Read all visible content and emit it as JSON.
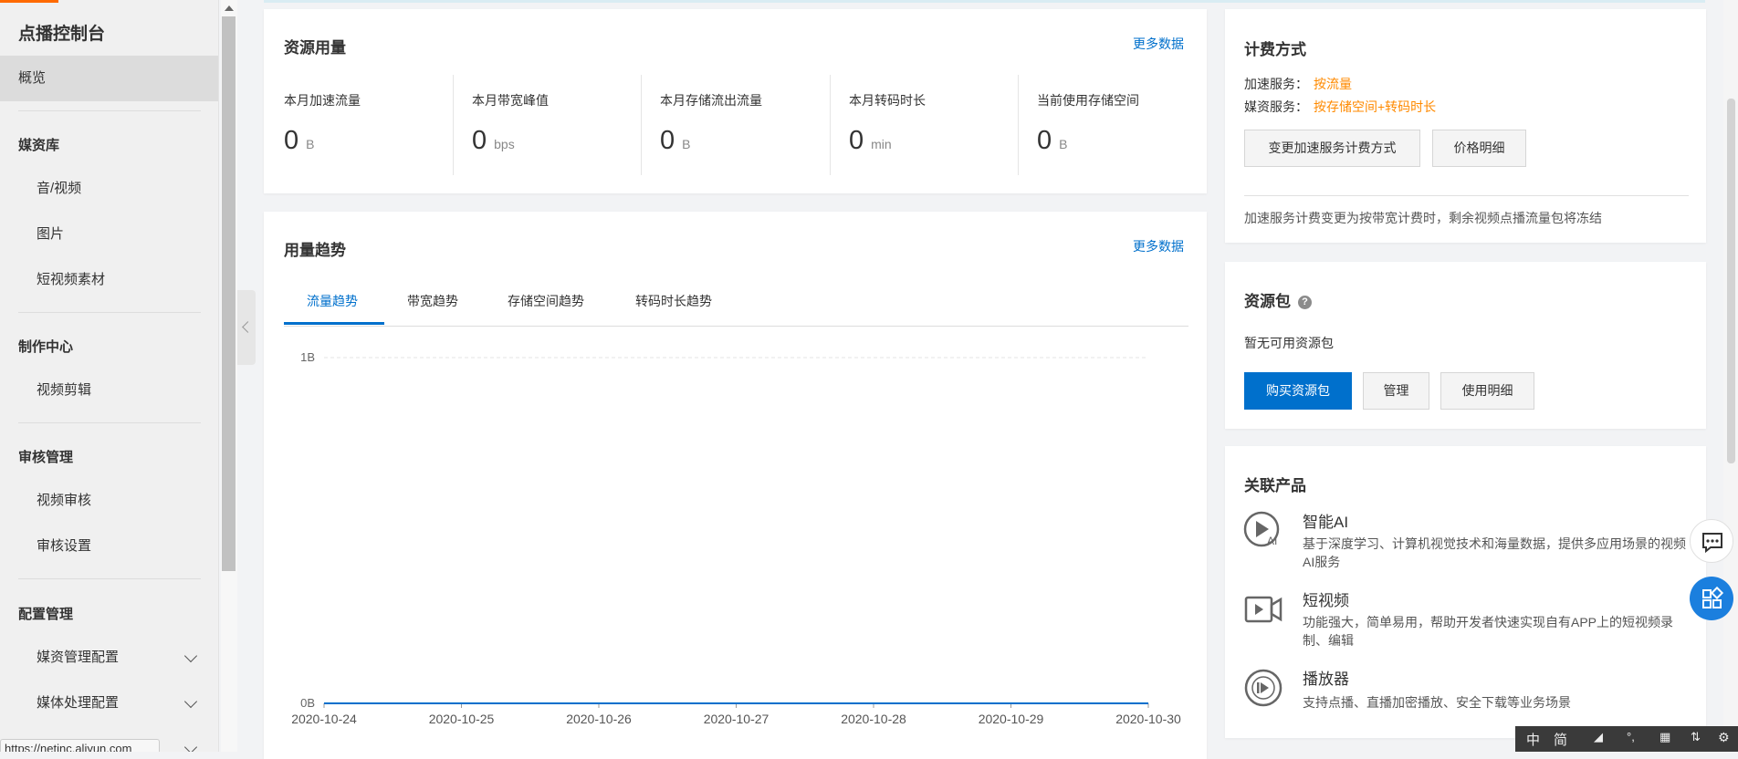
{
  "sidebar": {
    "title": "点播控制台",
    "overview": "概览",
    "groups": [
      {
        "label": "媒资库"
      },
      {
        "label": "制作中心"
      },
      {
        "label": "审核管理"
      },
      {
        "label": "配置管理"
      }
    ],
    "items": [
      "音/视频",
      "图片",
      "短视频素材",
      "视频剪辑",
      "视频审核",
      "审核设置",
      "媒资管理配置",
      "媒体处理配置"
    ],
    "status_url": "https://netinc.aliyun.com"
  },
  "resource_usage": {
    "title": "资源用量",
    "more": "更多数据",
    "metrics": [
      {
        "label": "本月加速流量",
        "value": "0",
        "unit": "B"
      },
      {
        "label": "本月带宽峰值",
        "value": "0",
        "unit": "bps"
      },
      {
        "label": "本月存储流出流量",
        "value": "0",
        "unit": "B"
      },
      {
        "label": "本月转码时长",
        "value": "0",
        "unit": "min"
      },
      {
        "label": "当前使用存储空间",
        "value": "0",
        "unit": "B"
      }
    ]
  },
  "usage_trend": {
    "title": "用量趋势",
    "more": "更多数据",
    "tabs": [
      "流量趋势",
      "带宽趋势",
      "存储空间趋势",
      "转码时长趋势"
    ],
    "active_tab": 0
  },
  "chart_data": {
    "type": "line",
    "x": [
      "2020-10-24",
      "2020-10-25",
      "2020-10-26",
      "2020-10-27",
      "2020-10-28",
      "2020-10-29",
      "2020-10-30"
    ],
    "series": [
      {
        "values": [
          0,
          0,
          0,
          0,
          0,
          0,
          0
        ]
      }
    ],
    "y_ticks": [
      "0B",
      "1B"
    ],
    "ylim": [
      0,
      1
    ],
    "grid": true,
    "line_color": "#0070cc"
  },
  "billing": {
    "title": "计费方式",
    "accel_label": "加速服务：",
    "accel_value": "按流量",
    "media_label": "媒资服务：",
    "media_value": "按存储空间+转码时长",
    "change_btn": "变更加速服务计费方式",
    "price_btn": "价格明细",
    "notice": "加速服务计费变更为按带宽计费时，剩余视频点播流量包将冻结"
  },
  "resource_pack": {
    "title": "资源包",
    "help": "?",
    "empty": "暂无可用资源包",
    "buy_btn": "购买资源包",
    "manage_btn": "管理",
    "detail_btn": "使用明细"
  },
  "related": {
    "title": "关联产品",
    "products": [
      {
        "name": "智能AI",
        "desc": "基于深度学习、计算机视觉技术和海量数据，提供多应用场景的视频AI服务",
        "icon": "ai-play-icon"
      },
      {
        "name": "短视频",
        "desc": "功能强大，简单易用，帮助开发者快速实现自有APP上的短视频录制、编辑",
        "icon": "video-camera-icon"
      },
      {
        "name": "播放器",
        "desc": "支持点播、直播加密播放、安全下载等业务场景",
        "icon": "player-icon"
      }
    ]
  },
  "ime": {
    "lang": "中",
    "mode": "简"
  },
  "colors": {
    "accent": "#0070cc",
    "orange": "#ff8a00",
    "fab": "#1b7fde"
  }
}
